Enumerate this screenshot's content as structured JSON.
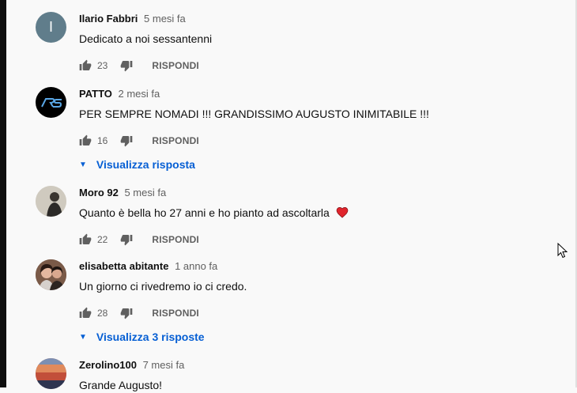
{
  "comments": [
    {
      "author": "Ilario Fabbri",
      "time": "5 mesi fa",
      "text": "Dedicato a noi sessantenni",
      "likes": "23",
      "reply": "RISPONDI",
      "avatar": "I",
      "avatar_color": "#607d8b"
    },
    {
      "author": "PATTO",
      "time": "2 mesi fa",
      "text": "PER SEMPRE NOMADI !!! GRANDISSIMO AUGUSTO INIMITABILE !!!",
      "likes": "16",
      "reply": "RISPONDI",
      "replies": "Visualizza risposta",
      "avatar_color": "#000000"
    },
    {
      "author": "Moro 92",
      "time": "5 mesi fa",
      "text": "Quanto è bella ho 27 anni e ho pianto ad ascoltarla",
      "likes": "22",
      "reply": "RISPONDI",
      "avatar_color": "#8d8a7f"
    },
    {
      "author": "elisabetta abitante",
      "time": "1 anno fa",
      "text": "Un giorno ci rivedremo io ci credo.",
      "likes": "28",
      "reply": "RISPONDI",
      "replies": "Visualizza 3 risposte",
      "avatar_color": "#5a3a2e"
    },
    {
      "author": "Zerolino100",
      "time": "7 mesi fa",
      "text": "Grande Augusto!",
      "avatar_color": "#c0694a"
    }
  ]
}
